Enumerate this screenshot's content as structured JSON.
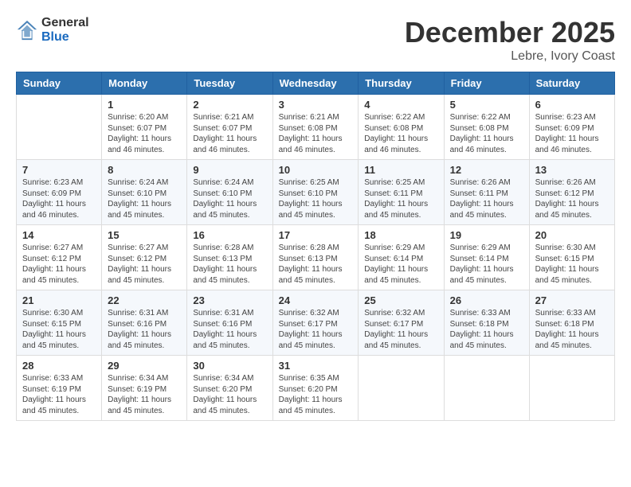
{
  "header": {
    "logo_general": "General",
    "logo_blue": "Blue",
    "month_year": "December 2025",
    "location": "Lebre, Ivory Coast"
  },
  "days_of_week": [
    "Sunday",
    "Monday",
    "Tuesday",
    "Wednesday",
    "Thursday",
    "Friday",
    "Saturday"
  ],
  "weeks": [
    [
      {
        "day": "",
        "sunrise": "",
        "sunset": "",
        "daylight": ""
      },
      {
        "day": "1",
        "sunrise": "Sunrise: 6:20 AM",
        "sunset": "Sunset: 6:07 PM",
        "daylight": "Daylight: 11 hours and 46 minutes."
      },
      {
        "day": "2",
        "sunrise": "Sunrise: 6:21 AM",
        "sunset": "Sunset: 6:07 PM",
        "daylight": "Daylight: 11 hours and 46 minutes."
      },
      {
        "day": "3",
        "sunrise": "Sunrise: 6:21 AM",
        "sunset": "Sunset: 6:08 PM",
        "daylight": "Daylight: 11 hours and 46 minutes."
      },
      {
        "day": "4",
        "sunrise": "Sunrise: 6:22 AM",
        "sunset": "Sunset: 6:08 PM",
        "daylight": "Daylight: 11 hours and 46 minutes."
      },
      {
        "day": "5",
        "sunrise": "Sunrise: 6:22 AM",
        "sunset": "Sunset: 6:08 PM",
        "daylight": "Daylight: 11 hours and 46 minutes."
      },
      {
        "day": "6",
        "sunrise": "Sunrise: 6:23 AM",
        "sunset": "Sunset: 6:09 PM",
        "daylight": "Daylight: 11 hours and 46 minutes."
      }
    ],
    [
      {
        "day": "7",
        "sunrise": "Sunrise: 6:23 AM",
        "sunset": "Sunset: 6:09 PM",
        "daylight": "Daylight: 11 hours and 46 minutes."
      },
      {
        "day": "8",
        "sunrise": "Sunrise: 6:24 AM",
        "sunset": "Sunset: 6:10 PM",
        "daylight": "Daylight: 11 hours and 45 minutes."
      },
      {
        "day": "9",
        "sunrise": "Sunrise: 6:24 AM",
        "sunset": "Sunset: 6:10 PM",
        "daylight": "Daylight: 11 hours and 45 minutes."
      },
      {
        "day": "10",
        "sunrise": "Sunrise: 6:25 AM",
        "sunset": "Sunset: 6:10 PM",
        "daylight": "Daylight: 11 hours and 45 minutes."
      },
      {
        "day": "11",
        "sunrise": "Sunrise: 6:25 AM",
        "sunset": "Sunset: 6:11 PM",
        "daylight": "Daylight: 11 hours and 45 minutes."
      },
      {
        "day": "12",
        "sunrise": "Sunrise: 6:26 AM",
        "sunset": "Sunset: 6:11 PM",
        "daylight": "Daylight: 11 hours and 45 minutes."
      },
      {
        "day": "13",
        "sunrise": "Sunrise: 6:26 AM",
        "sunset": "Sunset: 6:12 PM",
        "daylight": "Daylight: 11 hours and 45 minutes."
      }
    ],
    [
      {
        "day": "14",
        "sunrise": "Sunrise: 6:27 AM",
        "sunset": "Sunset: 6:12 PM",
        "daylight": "Daylight: 11 hours and 45 minutes."
      },
      {
        "day": "15",
        "sunrise": "Sunrise: 6:27 AM",
        "sunset": "Sunset: 6:12 PM",
        "daylight": "Daylight: 11 hours and 45 minutes."
      },
      {
        "day": "16",
        "sunrise": "Sunrise: 6:28 AM",
        "sunset": "Sunset: 6:13 PM",
        "daylight": "Daylight: 11 hours and 45 minutes."
      },
      {
        "day": "17",
        "sunrise": "Sunrise: 6:28 AM",
        "sunset": "Sunset: 6:13 PM",
        "daylight": "Daylight: 11 hours and 45 minutes."
      },
      {
        "day": "18",
        "sunrise": "Sunrise: 6:29 AM",
        "sunset": "Sunset: 6:14 PM",
        "daylight": "Daylight: 11 hours and 45 minutes."
      },
      {
        "day": "19",
        "sunrise": "Sunrise: 6:29 AM",
        "sunset": "Sunset: 6:14 PM",
        "daylight": "Daylight: 11 hours and 45 minutes."
      },
      {
        "day": "20",
        "sunrise": "Sunrise: 6:30 AM",
        "sunset": "Sunset: 6:15 PM",
        "daylight": "Daylight: 11 hours and 45 minutes."
      }
    ],
    [
      {
        "day": "21",
        "sunrise": "Sunrise: 6:30 AM",
        "sunset": "Sunset: 6:15 PM",
        "daylight": "Daylight: 11 hours and 45 minutes."
      },
      {
        "day": "22",
        "sunrise": "Sunrise: 6:31 AM",
        "sunset": "Sunset: 6:16 PM",
        "daylight": "Daylight: 11 hours and 45 minutes."
      },
      {
        "day": "23",
        "sunrise": "Sunrise: 6:31 AM",
        "sunset": "Sunset: 6:16 PM",
        "daylight": "Daylight: 11 hours and 45 minutes."
      },
      {
        "day": "24",
        "sunrise": "Sunrise: 6:32 AM",
        "sunset": "Sunset: 6:17 PM",
        "daylight": "Daylight: 11 hours and 45 minutes."
      },
      {
        "day": "25",
        "sunrise": "Sunrise: 6:32 AM",
        "sunset": "Sunset: 6:17 PM",
        "daylight": "Daylight: 11 hours and 45 minutes."
      },
      {
        "day": "26",
        "sunrise": "Sunrise: 6:33 AM",
        "sunset": "Sunset: 6:18 PM",
        "daylight": "Daylight: 11 hours and 45 minutes."
      },
      {
        "day": "27",
        "sunrise": "Sunrise: 6:33 AM",
        "sunset": "Sunset: 6:18 PM",
        "daylight": "Daylight: 11 hours and 45 minutes."
      }
    ],
    [
      {
        "day": "28",
        "sunrise": "Sunrise: 6:33 AM",
        "sunset": "Sunset: 6:19 PM",
        "daylight": "Daylight: 11 hours and 45 minutes."
      },
      {
        "day": "29",
        "sunrise": "Sunrise: 6:34 AM",
        "sunset": "Sunset: 6:19 PM",
        "daylight": "Daylight: 11 hours and 45 minutes."
      },
      {
        "day": "30",
        "sunrise": "Sunrise: 6:34 AM",
        "sunset": "Sunset: 6:20 PM",
        "daylight": "Daylight: 11 hours and 45 minutes."
      },
      {
        "day": "31",
        "sunrise": "Sunrise: 6:35 AM",
        "sunset": "Sunset: 6:20 PM",
        "daylight": "Daylight: 11 hours and 45 minutes."
      },
      {
        "day": "",
        "sunrise": "",
        "sunset": "",
        "daylight": ""
      },
      {
        "day": "",
        "sunrise": "",
        "sunset": "",
        "daylight": ""
      },
      {
        "day": "",
        "sunrise": "",
        "sunset": "",
        "daylight": ""
      }
    ]
  ]
}
